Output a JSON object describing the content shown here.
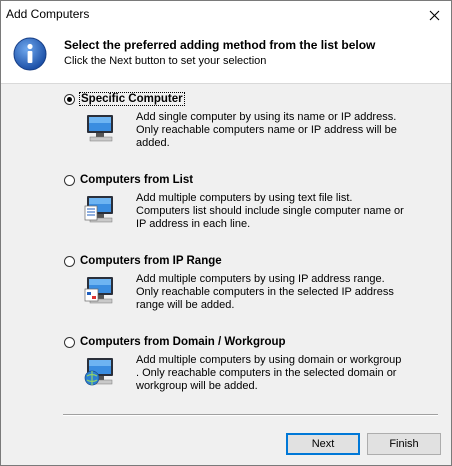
{
  "window": {
    "title": "Add Computers"
  },
  "header": {
    "title": "Select the preferred adding method from the list below",
    "subtitle": "Click the Next button to set your selection"
  },
  "options": [
    {
      "label": "Specific Computer",
      "selected": true,
      "description": "Add single computer by using its name or IP address. Only reachable computers name or IP address will be added.",
      "icon": "single-computer-icon"
    },
    {
      "label": "Computers from List",
      "selected": false,
      "description": "Add multiple computers by using text file list. Computers list should include single computer name or IP address in each line.",
      "icon": "computer-list-icon"
    },
    {
      "label": "Computers from IP Range",
      "selected": false,
      "description": "Add multiple computers by using IP address range. Only reachable computers in the selected IP address range will be added.",
      "icon": "ip-range-icon"
    },
    {
      "label": "Computers from Domain / Workgroup",
      "selected": false,
      "description": "Add multiple computers by using domain or workgroup . Only reachable computers in the selected domain or workgroup will be added.",
      "icon": "domain-workgroup-icon"
    }
  ],
  "buttons": {
    "next": "Next",
    "finish": "Finish"
  },
  "colors": {
    "accent": "#0078d7",
    "header_bg": "#ffffff",
    "body_bg": "#f0f0f0"
  }
}
